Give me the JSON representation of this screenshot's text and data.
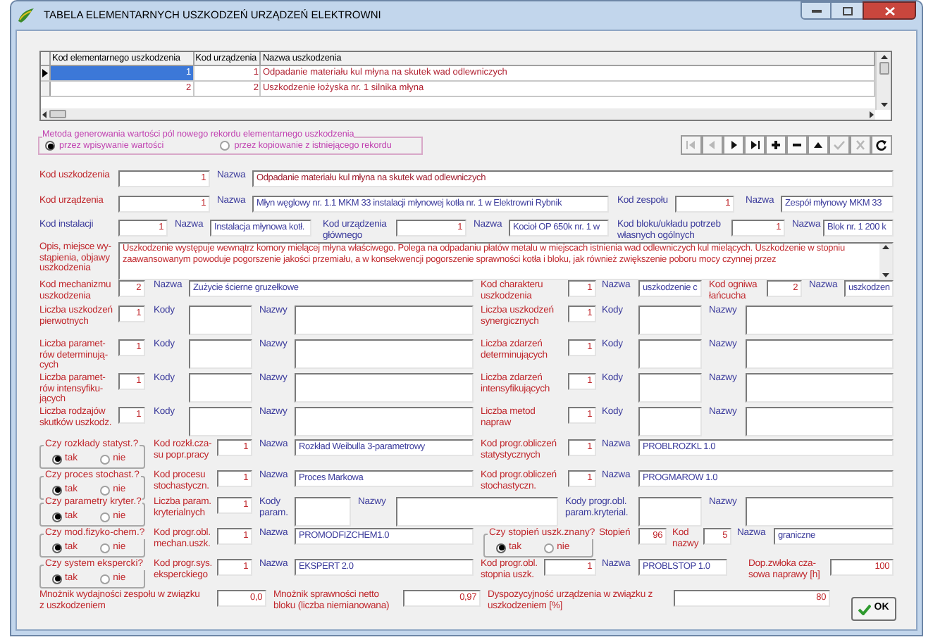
{
  "window": {
    "title": "TABELA ELEMENTARNYCH USZKODZEŃ URZĄDZEŃ ELEKTROWNI"
  },
  "grid": {
    "columns": [
      "Kod elementarnego uszkodzenia",
      "Kod urządzenia",
      "Nazwa uszkodzenia"
    ],
    "rows": [
      {
        "cells": [
          "1",
          "1",
          "Odpadanie materiału kul młyna na skutek wad odlewniczych"
        ],
        "selected": true
      },
      {
        "cells": [
          "2",
          "2",
          "Uszkodzenie łożyska nr. 1 silnika młyna"
        ],
        "selected": false
      }
    ]
  },
  "generation_method": {
    "label": "Metoda generowania wartości pól nowego rekordu elementarnego uszkodzenia",
    "options": [
      {
        "label": "przez wpisywanie wartości",
        "selected": true
      },
      {
        "label": "przez kopiowanie z istniejącego rekordu",
        "selected": false
      }
    ]
  },
  "nav_buttons": [
    {
      "kind": "first",
      "disabled": true
    },
    {
      "kind": "prior",
      "disabled": true
    },
    {
      "kind": "next",
      "disabled": false
    },
    {
      "kind": "last",
      "disabled": false
    },
    {
      "kind": "insert",
      "disabled": false
    },
    {
      "kind": "delete",
      "disabled": false
    },
    {
      "kind": "edit",
      "disabled": false
    },
    {
      "kind": "post",
      "disabled": true
    },
    {
      "kind": "cancel",
      "disabled": true
    },
    {
      "kind": "refresh",
      "disabled": false
    }
  ],
  "form_rows": [
    [
      {
        "kind": "label",
        "text": "Kod uszkodzenia",
        "color": "#c0282d"
      },
      {
        "kind": "number",
        "value": "1",
        "color": "#c0282d"
      },
      {
        "kind": "label",
        "text": "Nazwa",
        "color": "#3c3c9c"
      },
      {
        "kind": "text",
        "value": "Odpadanie materiału kul młyna na skutek wad odlewniczych",
        "color": "#a02030"
      }
    ],
    [
      {
        "kind": "label",
        "text": "Kod urządzenia",
        "color": "#c0282d"
      },
      {
        "kind": "number",
        "value": "1",
        "color": "#c0282d"
      },
      {
        "kind": "label",
        "text": "Nazwa",
        "color": "#3c3c9c"
      },
      {
        "kind": "text",
        "value": "Młyn węglowy nr. 1.1 MKM 33 instalacji młynowej kotła nr. 1 w Elektrowni Rybnik",
        "color": "#3c3c9c"
      },
      {
        "kind": "label",
        "text": "Kod zespołu",
        "color": "#3c3c9c"
      },
      {
        "kind": "number",
        "value": "1",
        "color": "#c0282d"
      },
      {
        "kind": "label",
        "text": "Nazwa",
        "color": "#3c3c9c"
      },
      {
        "kind": "text",
        "value": "Zespół młynowy MKM 33",
        "color": "#3c3c9c"
      }
    ],
    [
      {
        "kind": "label",
        "text": "Kod instalacji",
        "color": "#3c3c9c"
      },
      {
        "kind": "number",
        "value": "1",
        "color": "#c0282d"
      },
      {
        "kind": "label",
        "text": "Nazwa",
        "color": "#3c3c9c"
      },
      {
        "kind": "text",
        "value": "Instalacja młynowa kotł.",
        "color": "#3c3c9c"
      },
      {
        "kind": "label",
        "text": "Kod urządzenia\ngłównego",
        "color": "#3c3c9c"
      },
      {
        "kind": "number",
        "value": "1",
        "color": "#c0282d"
      },
      {
        "kind": "label",
        "text": "Nazwa",
        "color": "#3c3c9c"
      },
      {
        "kind": "text",
        "value": "Kocioł OP 650k nr. 1 w",
        "color": "#3c3c9c"
      },
      {
        "kind": "label",
        "text": "Kod bloku/układu potrzeb\nwłasnych ogólnych",
        "color": "#3c3c9c"
      },
      {
        "kind": "number",
        "value": "1",
        "color": "#c0282d"
      },
      {
        "kind": "label",
        "text": "Nazwa",
        "color": "#3c3c9c"
      },
      {
        "kind": "text",
        "value": "Blok nr. 1 200 k",
        "color": "#3c3c9c"
      }
    ],
    [
      {
        "kind": "label",
        "text": "Opis, miejsce wy-\nstąpienia, objawy\nuszkodzenia",
        "color": "#c0282d"
      },
      {
        "kind": "memo",
        "value": "Uszkodzenie występuje wewnątrz komory mielącej młyna właściwego. Polega na odpadaniu płatów metalu w miejscach istnienia wad odlewniczych kul mielących. Uszkodzenie w stopniu zaawansowanym powoduje pogorszenie jakości przemiału, a w konsekwencji pogorszenie sprawności kotła i bloku, jak również zwiększenie poboru mocy czynnej przez",
        "color": "#c0282d"
      }
    ],
    [
      {
        "kind": "label",
        "text": "Kod mechanizmu\nuszkodzenia",
        "color": "#c0282d"
      },
      {
        "kind": "number",
        "value": "2",
        "color": "#c0282d"
      },
      {
        "kind": "label",
        "text": "Nazwa",
        "color": "#3c3c9c"
      },
      {
        "kind": "text",
        "value": "Zużycie ścierne gruzełkowe",
        "color": "#3c3c9c"
      },
      {
        "kind": "label",
        "text": "Kod charakteru\nuszkodzenia",
        "color": "#c0282d"
      },
      {
        "kind": "number",
        "value": "1",
        "color": "#c0282d"
      },
      {
        "kind": "label",
        "text": "Nazwa",
        "color": "#3c3c9c"
      },
      {
        "kind": "text",
        "value": "uszkodzenie c",
        "color": "#3c3c9c"
      },
      {
        "kind": "label",
        "text": "Kod ogniwa\nłańcucha",
        "color": "#c0282d"
      },
      {
        "kind": "number",
        "value": "2",
        "color": "#c0282d"
      },
      {
        "kind": "label",
        "text": "Nazwa",
        "color": "#3c3c9c"
      },
      {
        "kind": "text",
        "value": "uszkodzen",
        "color": "#3c3c9c"
      }
    ],
    [
      {
        "kind": "label",
        "text": "Liczba uszkodzeń\npierwotnych",
        "color": "#c0282d"
      },
      {
        "kind": "number",
        "value": "1",
        "color": "#c0282d"
      },
      {
        "kind": "label",
        "text": "Kody",
        "color": "#3c3c9c"
      },
      {
        "kind": "box"
      },
      {
        "kind": "label",
        "text": "Nazwy",
        "color": "#3c3c9c"
      },
      {
        "kind": "box"
      },
      {
        "kind": "label",
        "text": "Liczba uszkodzeń\nsynergicznych",
        "color": "#c0282d"
      },
      {
        "kind": "number",
        "value": "1",
        "color": "#c0282d"
      },
      {
        "kind": "label",
        "text": "Kody",
        "color": "#3c3c9c"
      },
      {
        "kind": "box"
      },
      {
        "kind": "label",
        "text": "Nazwy",
        "color": "#3c3c9c"
      },
      {
        "kind": "box"
      }
    ],
    [
      {
        "kind": "label",
        "text": "Liczba paramet-\nrów determinują-\ncych",
        "color": "#c0282d"
      },
      {
        "kind": "number",
        "value": "1",
        "color": "#c0282d"
      },
      {
        "kind": "label",
        "text": "Kody",
        "color": "#3c3c9c"
      },
      {
        "kind": "box"
      },
      {
        "kind": "label",
        "text": "Nazwy",
        "color": "#3c3c9c"
      },
      {
        "kind": "box"
      },
      {
        "kind": "label",
        "text": "Liczba zdarzeń\ndeterminujących",
        "color": "#c0282d"
      },
      {
        "kind": "number",
        "value": "1",
        "color": "#c0282d"
      },
      {
        "kind": "label",
        "text": "Kody",
        "color": "#3c3c9c"
      },
      {
        "kind": "box"
      },
      {
        "kind": "label",
        "text": "Nazwy",
        "color": "#3c3c9c"
      },
      {
        "kind": "box"
      }
    ],
    [
      {
        "kind": "label",
        "text": "Liczba paramet-\nrów intensyfiku-\njących",
        "color": "#c0282d"
      },
      {
        "kind": "number",
        "value": "1",
        "color": "#c0282d"
      },
      {
        "kind": "label",
        "text": "Kody",
        "color": "#3c3c9c"
      },
      {
        "kind": "box"
      },
      {
        "kind": "label",
        "text": "Nazwy",
        "color": "#3c3c9c"
      },
      {
        "kind": "box"
      },
      {
        "kind": "label",
        "text": "Liczba zdarzeń\nintensyfikujących",
        "color": "#c0282d"
      },
      {
        "kind": "number",
        "value": "1",
        "color": "#c0282d"
      },
      {
        "kind": "label",
        "text": "Kody",
        "color": "#3c3c9c"
      },
      {
        "kind": "box"
      },
      {
        "kind": "label",
        "text": "Nazwy",
        "color": "#3c3c9c"
      },
      {
        "kind": "box"
      }
    ],
    [
      {
        "kind": "label",
        "text": "Liczba rodzajów\nskutków uszkodz.",
        "color": "#c0282d"
      },
      {
        "kind": "number",
        "value": "1",
        "color": "#c0282d"
      },
      {
        "kind": "label",
        "text": "Kody",
        "color": "#3c3c9c"
      },
      {
        "kind": "box"
      },
      {
        "kind": "label",
        "text": "Nazwy",
        "color": "#3c3c9c"
      },
      {
        "kind": "box"
      },
      {
        "kind": "label",
        "text": "Liczba metod\nnapraw",
        "color": "#c0282d"
      },
      {
        "kind": "number",
        "value": "1",
        "color": "#c0282d"
      },
      {
        "kind": "label",
        "text": "Kody",
        "color": "#3c3c9c"
      },
      {
        "kind": "box"
      },
      {
        "kind": "label",
        "text": "Nazwy",
        "color": "#3c3c9c"
      },
      {
        "kind": "box"
      }
    ],
    [
      {
        "kind": "radio_group",
        "label": "Czy rozkłady statyst.?",
        "color": "#c0282d",
        "options": [
          {
            "label": "tak",
            "selected": true
          },
          {
            "label": "nie",
            "selected": false
          }
        ]
      },
      {
        "kind": "label",
        "text": "Kod rozkł.cza-\nsu popr.pracy",
        "color": "#c0282d"
      },
      {
        "kind": "number",
        "value": "1",
        "color": "#c0282d"
      },
      {
        "kind": "label",
        "text": "Nazwa",
        "color": "#3c3c9c"
      },
      {
        "kind": "text",
        "value": "Rozkład Weibulla 3-parametrowy",
        "color": "#3c3c9c"
      },
      {
        "kind": "label",
        "text": "Kod progr.obliczeń\nstatystycznych",
        "color": "#c0282d"
      },
      {
        "kind": "number",
        "value": "1",
        "color": "#c0282d"
      },
      {
        "kind": "label",
        "text": "Nazwa",
        "color": "#3c3c9c"
      },
      {
        "kind": "text",
        "value": "PROBLROZKL 1.0",
        "color": "#3c3c9c"
      }
    ],
    [
      {
        "kind": "radio_group",
        "label": "Czy proces stochast.?",
        "color": "#c0282d",
        "options": [
          {
            "label": "tak",
            "selected": true
          },
          {
            "label": "nie",
            "selected": false
          }
        ]
      },
      {
        "kind": "label",
        "text": "Kod procesu\nstochastyczn.",
        "color": "#c0282d"
      },
      {
        "kind": "number",
        "value": "1",
        "color": "#c0282d"
      },
      {
        "kind": "label",
        "text": "Nazwa",
        "color": "#3c3c9c"
      },
      {
        "kind": "text",
        "value": "Proces Markowa",
        "color": "#3c3c9c"
      },
      {
        "kind": "label",
        "text": "Kod progr.obliczeń\nstochastyczn.",
        "color": "#c0282d"
      },
      {
        "kind": "number",
        "value": "1",
        "color": "#c0282d"
      },
      {
        "kind": "label",
        "text": "Nazwa",
        "color": "#3c3c9c"
      },
      {
        "kind": "text",
        "value": "PROGMAROW 1.0",
        "color": "#3c3c9c"
      }
    ],
    [
      {
        "kind": "radio_group",
        "label": "Czy parametry kryter.?",
        "color": "#c0282d",
        "options": [
          {
            "label": "tak",
            "selected": true
          },
          {
            "label": "nie",
            "selected": false
          }
        ]
      },
      {
        "kind": "label",
        "text": "Liczba param.\nkryterialnych",
        "color": "#c0282d"
      },
      {
        "kind": "number",
        "value": "1",
        "color": "#c0282d"
      },
      {
        "kind": "label",
        "text": "Kody\nparam.",
        "color": "#3c3c9c"
      },
      {
        "kind": "box"
      },
      {
        "kind": "label",
        "text": "Nazwy",
        "color": "#3c3c9c"
      },
      {
        "kind": "box"
      },
      {
        "kind": "label",
        "text": "Kody progr.obl.\nparam.kryterial.",
        "color": "#3c3c9c"
      },
      {
        "kind": "box"
      },
      {
        "kind": "label",
        "text": "Nazwy",
        "color": "#3c3c9c"
      },
      {
        "kind": "box"
      }
    ],
    [
      {
        "kind": "radio_group",
        "label": "Czy mod.fizyko-chem.?",
        "color": "#c0282d",
        "options": [
          {
            "label": "tak",
            "selected": true
          },
          {
            "label": "nie",
            "selected": false
          }
        ]
      },
      {
        "kind": "label",
        "text": "Kod progr.obl.\nmechan.uszk.",
        "color": "#c0282d"
      },
      {
        "kind": "number",
        "value": "1",
        "color": "#c0282d"
      },
      {
        "kind": "label",
        "text": "Nazwa",
        "color": "#3c3c9c"
      },
      {
        "kind": "text",
        "value": "PROMODFIZCHEM1.0",
        "color": "#3c3c9c"
      },
      {
        "kind": "radio_group",
        "label": "Czy stopień uszk.znany?",
        "color": "#c0282d",
        "options": [
          {
            "label": "tak",
            "selected": true
          },
          {
            "label": "nie",
            "selected": false
          }
        ]
      },
      {
        "kind": "label",
        "text": "Stopień",
        "color": "#c0282d"
      },
      {
        "kind": "number",
        "value": "96",
        "color": "#c0282d"
      },
      {
        "kind": "label",
        "text": "Kod\nnazwy",
        "color": "#c0282d"
      },
      {
        "kind": "number",
        "value": "5",
        "color": "#c0282d"
      },
      {
        "kind": "label",
        "text": "Nazwa",
        "color": "#3c3c9c"
      },
      {
        "kind": "text",
        "value": "graniczne",
        "color": "#3c3c9c"
      }
    ],
    [
      {
        "kind": "radio_group",
        "label": "Czy system ekspercki?",
        "color": "#c0282d",
        "options": [
          {
            "label": "tak",
            "selected": true
          },
          {
            "label": "nie",
            "selected": false
          }
        ]
      },
      {
        "kind": "label",
        "text": "Kod progr.sys.\neksperckiego",
        "color": "#c0282d"
      },
      {
        "kind": "number",
        "value": "1",
        "color": "#c0282d"
      },
      {
        "kind": "label",
        "text": "Nazwa",
        "color": "#3c3c9c"
      },
      {
        "kind": "text",
        "value": "EKSPERT 2.0",
        "color": "#3c3c9c"
      },
      {
        "kind": "label",
        "text": "Kod progr.obl.\nstopnia uszk.",
        "color": "#c0282d"
      },
      {
        "kind": "number",
        "value": "1",
        "color": "#c0282d"
      },
      {
        "kind": "label",
        "text": "Nazwa",
        "color": "#3c3c9c"
      },
      {
        "kind": "text",
        "value": "PROBLSTOP 1.0",
        "color": "#3c3c9c"
      },
      {
        "kind": "label",
        "text": "Dop.zwłoka cza-\nsowa naprawy [h]",
        "color": "#c0282d"
      },
      {
        "kind": "number",
        "value": "100",
        "color": "#c0282d"
      }
    ],
    [
      {
        "kind": "label",
        "text": "Mnożnik wydajności zespołu w związku\nz uszkodzeniem",
        "color": "#c0282d"
      },
      {
        "kind": "number",
        "value": "0,0",
        "color": "#c0282d"
      },
      {
        "kind": "label",
        "text": "Mnożnik sprawności netto\nbloku (liczba niemianowana)",
        "color": "#c0282d"
      },
      {
        "kind": "number",
        "value": "0,97",
        "color": "#c0282d"
      },
      {
        "kind": "label",
        "text": "Dyspozycyjność urządzenia w związku z\nuszkodzeniem [%]",
        "color": "#c0282d"
      },
      {
        "kind": "number",
        "value": "80",
        "color": "#c0282d"
      },
      {
        "kind": "button",
        "label": "OK"
      }
    ]
  ]
}
